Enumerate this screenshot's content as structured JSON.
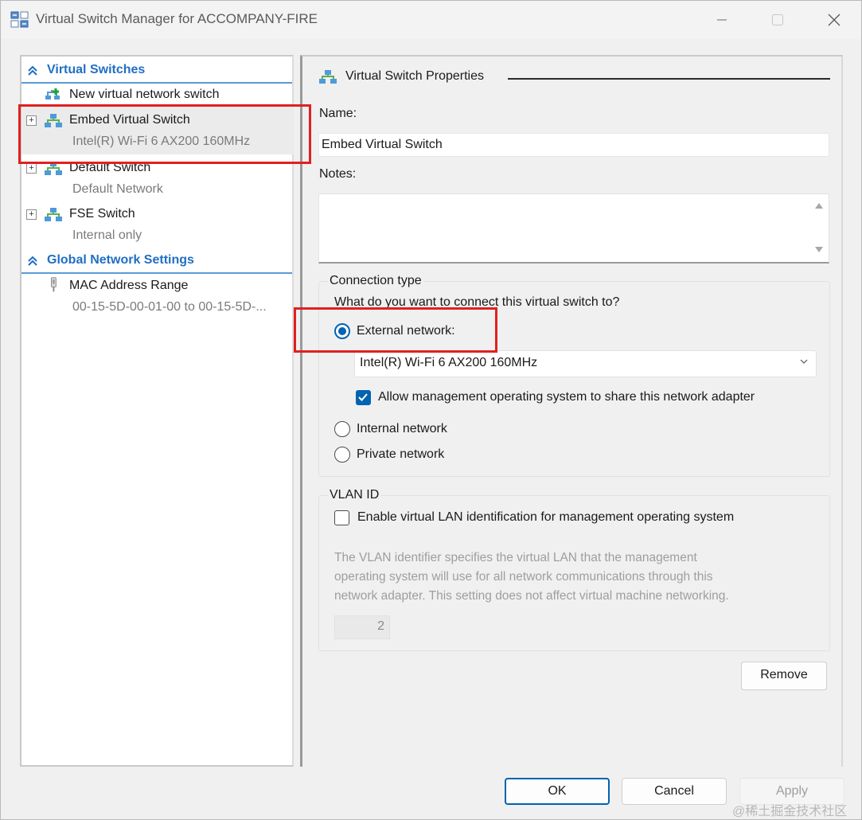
{
  "window": {
    "title": "Virtual Switch Manager for ACCOMPANY-FIRE",
    "icon": "virtual-switch-manager-icon"
  },
  "left_pane": {
    "virtual_switches_header": "Virtual Switches",
    "new_switch_label": "New virtual network switch",
    "switches": [
      {
        "name": "Embed Virtual Switch",
        "detail": "Intel(R) Wi-Fi 6 AX200 160MHz",
        "selected": true
      },
      {
        "name": "Default Switch",
        "detail": "Default Network",
        "selected": false
      },
      {
        "name": "FSE Switch",
        "detail": "Internal only",
        "selected": false
      }
    ],
    "global_header": "Global Network Settings",
    "mac_range": {
      "name": "MAC Address Range",
      "detail": "00-15-5D-00-01-00 to 00-15-5D-..."
    },
    "expander_glyph": "+"
  },
  "properties": {
    "header": "Virtual Switch Properties",
    "name_label": "Name:",
    "name_value": "Embed Virtual Switch",
    "notes_label": "Notes:",
    "notes_value": "",
    "connection_type": {
      "title": "Connection type",
      "question": "What do you want to connect this virtual switch to?",
      "external_label": "External network:",
      "external_selected": true,
      "adapter_selected": "Intel(R) Wi-Fi 6 AX200 160MHz",
      "allow_mgmt_label": "Allow management operating system to share this network adapter",
      "allow_mgmt_checked": true,
      "internal_label": "Internal network",
      "private_label": "Private network"
    },
    "vlan": {
      "title": "VLAN ID",
      "enable_label": "Enable virtual LAN identification for management operating system",
      "enable_checked": false,
      "description_lines": [
        "The VLAN identifier specifies the virtual LAN that the management",
        "operating system will use for all network communications through this",
        "network adapter. This setting does not affect virtual machine networking."
      ],
      "vlan_value": "2"
    },
    "remove_label": "Remove"
  },
  "footer": {
    "ok_label": "OK",
    "cancel_label": "Cancel",
    "apply_label": "Apply"
  },
  "watermark": "@稀土掘金技术社区",
  "colors": {
    "accent": "#0063b1",
    "section_header": "#1f6fc4",
    "highlight": "#e02020"
  }
}
